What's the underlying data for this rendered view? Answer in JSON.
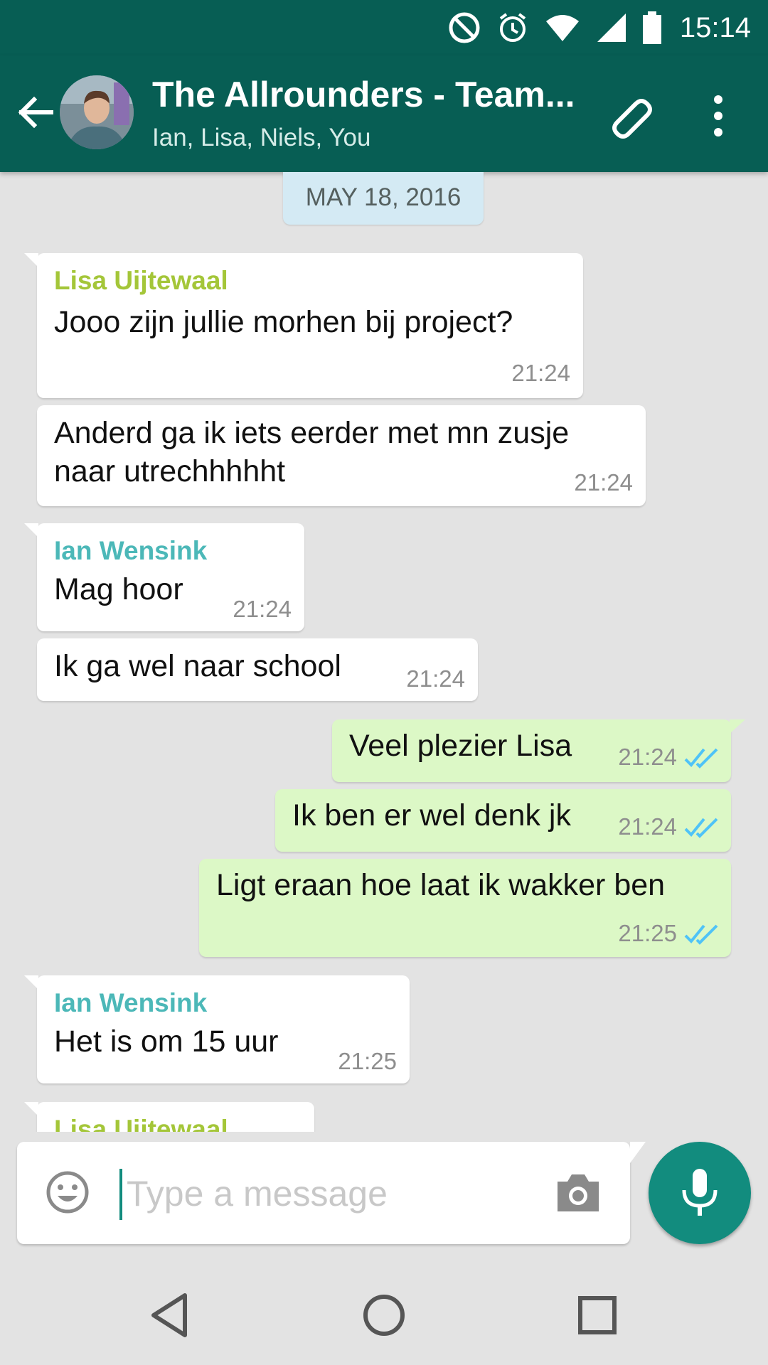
{
  "status_bar": {
    "time": "15:14",
    "icons": [
      "do-not-disturb-icon",
      "alarm-icon",
      "wifi-icon",
      "signal-icon",
      "battery-icon"
    ]
  },
  "header": {
    "title": "The Allrounders - Team...",
    "subtitle": "Ian, Lisa, Niels, You",
    "icons": [
      "back-arrow-icon",
      "attach-icon",
      "more-vert-icon"
    ]
  },
  "chat": {
    "date": "MAY 18, 2016",
    "messages": [
      {
        "direction": "in",
        "sender": "Lisa Uijtewaal",
        "text": "Jooo zijn jullie morhen bij project?",
        "time": "21:24"
      },
      {
        "direction": "in",
        "sender": "",
        "text": "Anderd ga ik iets eerder met mn zusje naar utrechhhhht",
        "time": "21:24"
      },
      {
        "direction": "in",
        "sender": "Ian Wensink",
        "text": "Mag hoor",
        "time": "21:24"
      },
      {
        "direction": "in",
        "sender": "",
        "text": "Ik ga wel naar school",
        "time": "21:24"
      },
      {
        "direction": "out",
        "sender": "",
        "text": "Veel plezier Lisa",
        "time": "21:24",
        "status": "read"
      },
      {
        "direction": "out",
        "sender": "",
        "text": "Ik ben er wel denk jk",
        "time": "21:24",
        "status": "read"
      },
      {
        "direction": "out",
        "sender": "",
        "text": "Ligt eraan hoe laat ik wakker ben",
        "time": "21:25",
        "status": "read"
      },
      {
        "direction": "in",
        "sender": "Ian Wensink",
        "text": "Het is om 15 uur",
        "time": "21:25"
      },
      {
        "direction": "in",
        "sender": "Lisa Uijtewaal",
        "text": "",
        "time": ""
      }
    ]
  },
  "composer": {
    "placeholder": "Type a message",
    "value": ""
  },
  "colors": {
    "primary_dark": "#075e54",
    "accent": "#128c7e",
    "outgoing_bubble": "#dcf8c6",
    "lisa_name": "#a4c639",
    "ian_name": "#4cb8b8",
    "read_ticks": "#4fc3f7"
  },
  "nav_bar": {
    "icons": [
      "back-triangle-icon",
      "home-circle-icon",
      "recents-square-icon"
    ]
  }
}
